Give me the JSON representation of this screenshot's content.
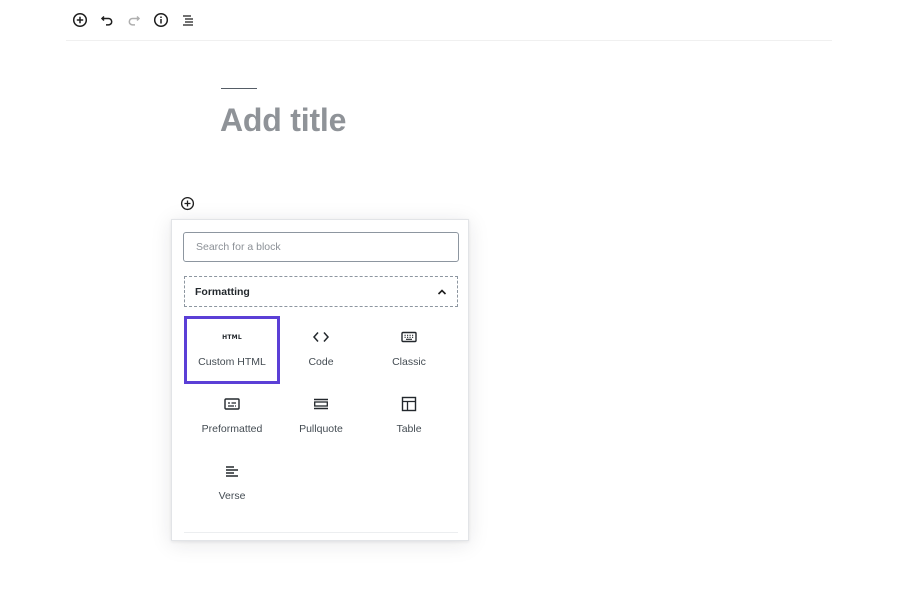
{
  "toolbar": {
    "buttons": [
      {
        "name": "add-block-button",
        "icon": "plus-circle-icon"
      },
      {
        "name": "undo-button",
        "icon": "undo-icon"
      },
      {
        "name": "redo-button",
        "icon": "redo-icon",
        "disabled": true
      },
      {
        "name": "info-button",
        "icon": "info-icon"
      },
      {
        "name": "outline-button",
        "icon": "list-outline-icon"
      }
    ]
  },
  "editor": {
    "title_placeholder": "Add title"
  },
  "inserter": {
    "search_placeholder": "Search for a block",
    "panel_title": "Formatting",
    "panel_expanded": true,
    "blocks": [
      {
        "label": "Custom HTML",
        "icon": "html-icon",
        "icon_text": "HTML",
        "selected": true
      },
      {
        "label": "Code",
        "icon": "code-icon"
      },
      {
        "label": "Classic",
        "icon": "keyboard-icon"
      },
      {
        "label": "Preformatted",
        "icon": "preformatted-icon"
      },
      {
        "label": "Pullquote",
        "icon": "pullquote-icon"
      },
      {
        "label": "Table",
        "icon": "table-icon"
      },
      {
        "label": "Verse",
        "icon": "verse-icon"
      }
    ]
  },
  "colors": {
    "selection": "#5b3fd6",
    "title_placeholder": "#8f9398"
  }
}
